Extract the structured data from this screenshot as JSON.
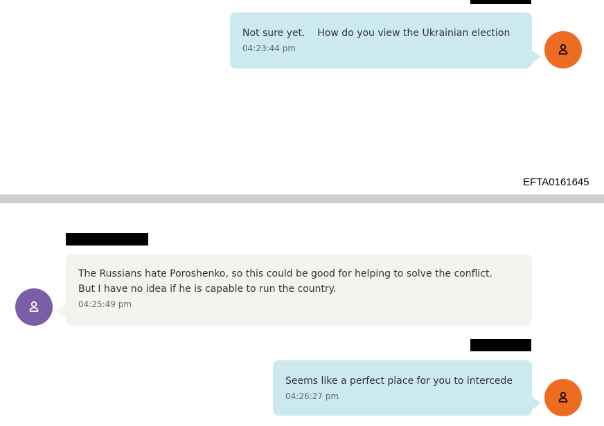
{
  "colors": {
    "sent_bubble": "#cde9f0",
    "received_bubble": "#f4f3f0",
    "avatar_self": "#ee6c22",
    "avatar_other": "#7b5ea7",
    "separator": "#d0d0d0",
    "text": "#333333",
    "timestamp": "#5f6b70"
  },
  "page_top": {
    "messages": [
      {
        "direction": "sent",
        "text": "Not sure yet.    How do you view the Ukrainian election",
        "time": "04:23:44 pm",
        "avatar_icon": "person-icon"
      }
    ],
    "footer_id": "EFTA0161645"
  },
  "page_bottom": {
    "messages": [
      {
        "direction": "received",
        "text": "The Russians hate Poroshenko, so this could be good for helping to solve the conflict.\nBut I have no idea if he is capable to run the country.",
        "time": "04:25:49 pm",
        "avatar_icon": "person-icon"
      },
      {
        "direction": "sent",
        "text": "Seems like a perfect place for you to intercede",
        "time": "04:26:27 pm",
        "avatar_icon": "person-icon"
      }
    ]
  }
}
